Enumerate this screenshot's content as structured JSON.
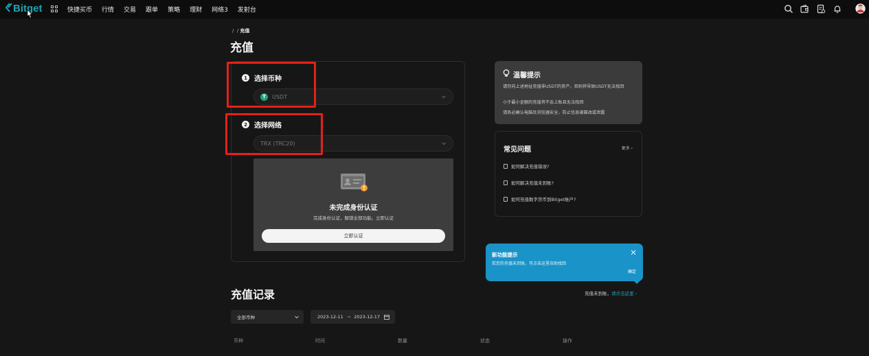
{
  "nav": {
    "logo": "Bitget",
    "items": [
      "快捷买币",
      "行情",
      "交易",
      "跟单",
      "策略",
      "理财",
      "网络3",
      "发射台"
    ]
  },
  "breadcrumb": {
    "sep1": "/",
    "sep2": "/",
    "current": "充值"
  },
  "page_title": "充值",
  "form": {
    "step1": {
      "num": "1",
      "label": "选择币种",
      "value": "USDT",
      "icon_letter": "T"
    },
    "step2": {
      "num": "2",
      "label": "选择网络",
      "value": "TRX (TRC20)"
    },
    "kyc": {
      "title": "未完成身份认证",
      "subtitle": "完成身份认证，解锁全部功能。立即认证",
      "button": "立即认证"
    }
  },
  "tips": {
    "title": "温馨提示",
    "lines": [
      "请勿向上述地址充值非USDT的资产，否则将导致USDT无法找回",
      "小于最小金额的充值将不会上账且无法找回",
      "请务必确认电脑及浏览器安全，防止信息被篡改或泄露"
    ]
  },
  "faq": {
    "title": "常见问题",
    "more": "更多 ›",
    "items": [
      "如何解决充值错误?",
      "如何解决充值未到账?",
      "如何充值数字货币到Bitget账户?"
    ]
  },
  "popup": {
    "title": "新功能提示",
    "body": "若您的充值未到账，可点击这里自助找回",
    "ok": "确定"
  },
  "records": {
    "title": "充值记录",
    "link_prefix": "充值未到账，",
    "link_text": "请点击这里 ›",
    "coin_filter": "全部币种",
    "date_from": "2023-12-11",
    "date_sep": "→",
    "date_to": "2023-12-17",
    "columns": [
      "币种",
      "时间",
      "数量",
      "状态",
      "操作"
    ]
  },
  "colors": {
    "accent": "#1da2b4",
    "highlight": "#e62117",
    "popup": "#1a93c8"
  }
}
